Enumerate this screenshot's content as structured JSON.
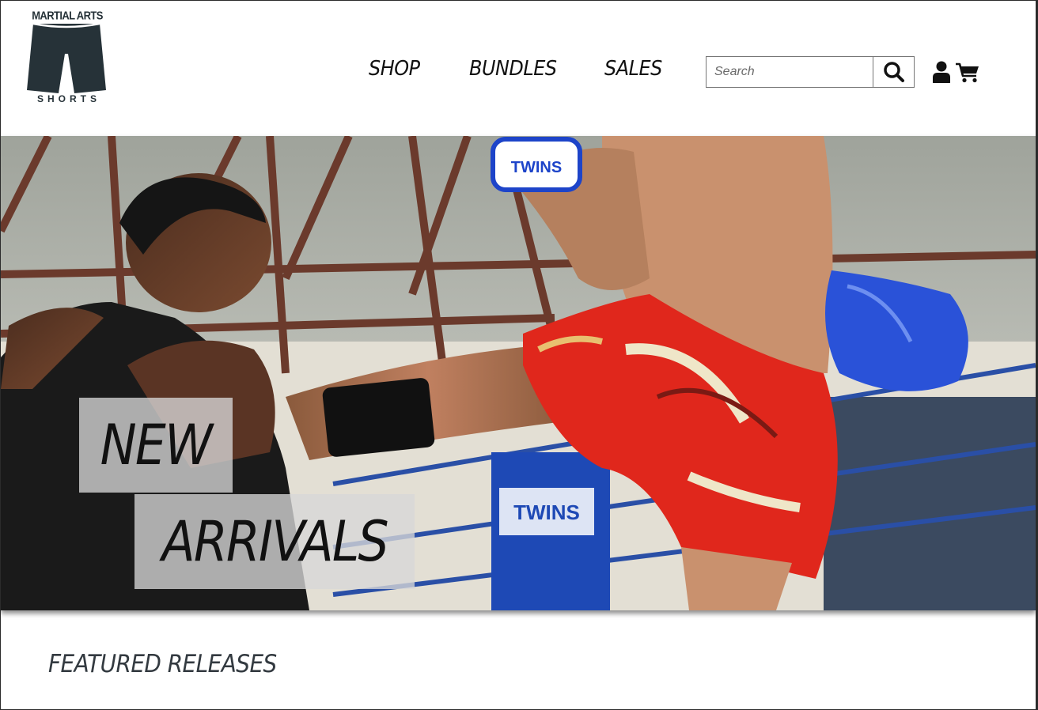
{
  "brand": {
    "logo_top": "MARTIAL ARTS",
    "logo_bottom": "SHORTS",
    "logo_color": "#263238"
  },
  "nav": {
    "items": [
      {
        "label": "SHOP"
      },
      {
        "label": "BUNDLES"
      },
      {
        "label": "SALES"
      }
    ]
  },
  "search": {
    "placeholder": "Search",
    "value": "",
    "icon": "search-icon"
  },
  "header_icons": {
    "account": "user-icon",
    "cart": "cart-icon"
  },
  "hero": {
    "image_description_icon": "muay-thai-hero-image",
    "banner_line1": "NEW",
    "banner_line2": "ARRIVALS"
  },
  "featured": {
    "title": "FEATURED RELEASES"
  },
  "colors": {
    "text": "#111111",
    "heading": "#333a40",
    "banner_bg": "#d7d7d7",
    "shorts_red": "#e0271c",
    "glove_blue": "#2a52d8"
  }
}
